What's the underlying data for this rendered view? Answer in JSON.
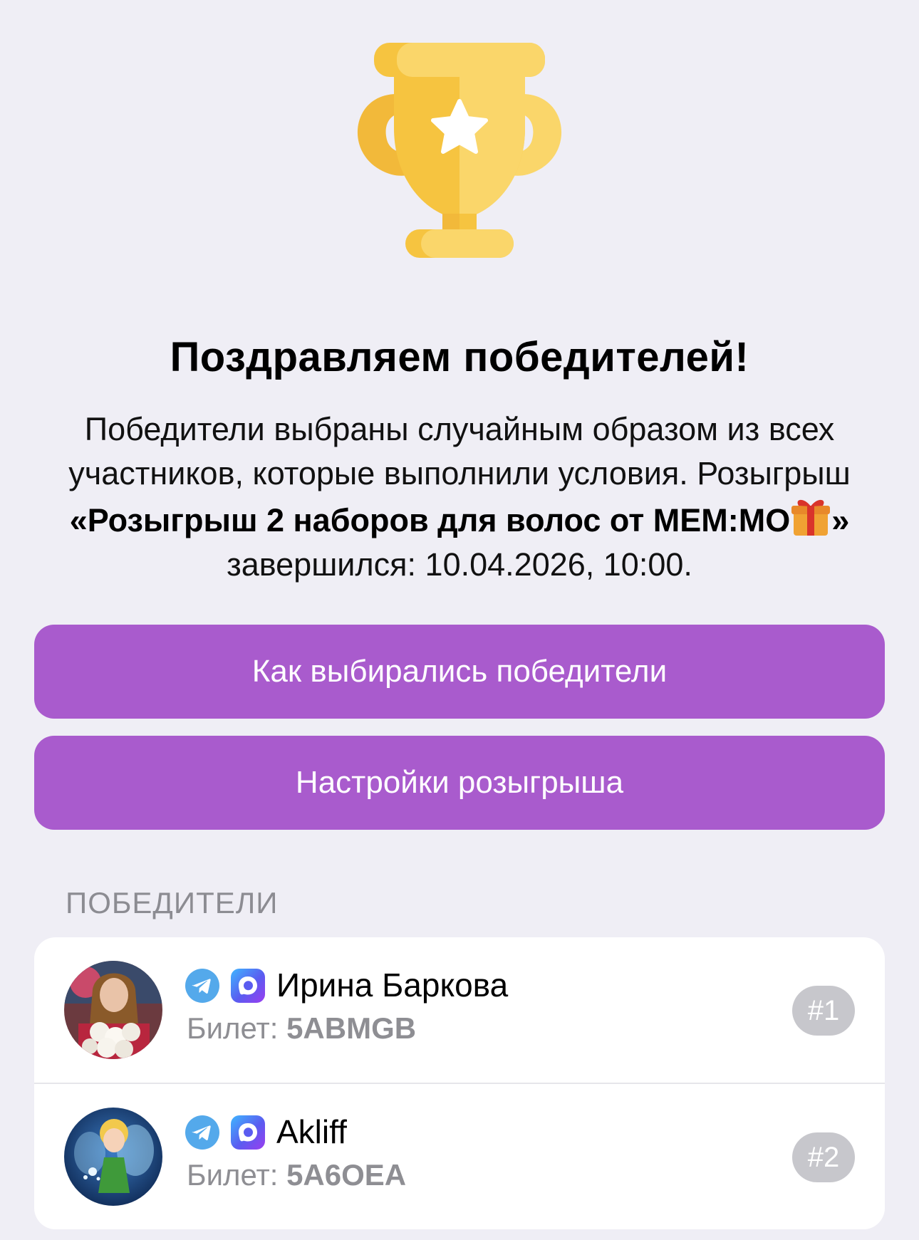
{
  "header": {
    "icon": "trophy-icon",
    "title": "Поздравляем победителей!"
  },
  "description": {
    "line1": "Победители выбраны случайным образом из всех участников, которые выполнили условия.",
    "prefix": "Розыгрыш",
    "giveaway_name": "«Розыгрыш 2 наборов для волос от MEM:MO",
    "giveaway_name_end": "»",
    "gift_icon": "gift-icon",
    "ended_text": "завершился: 10.04.2026, 10:00."
  },
  "buttons": {
    "how_selected": "Как выбирались победители",
    "settings": "Настройки розыгрыша"
  },
  "winners": {
    "section_label": "ПОБЕДИТЕЛИ",
    "ticket_label": "Билет:",
    "items": [
      {
        "name": "Ирина Баркова",
        "ticket": "5ABMGB",
        "rank": "#1"
      },
      {
        "name": "Akliff",
        "ticket": "5A6OEA",
        "rank": "#2"
      }
    ]
  },
  "colors": {
    "background": "#efeef5",
    "accent": "#a95bcd",
    "card": "#ffffff",
    "muted_text": "#8e8e93",
    "badge": "#c7c7cc",
    "trophy_gold": "#f6c440"
  }
}
